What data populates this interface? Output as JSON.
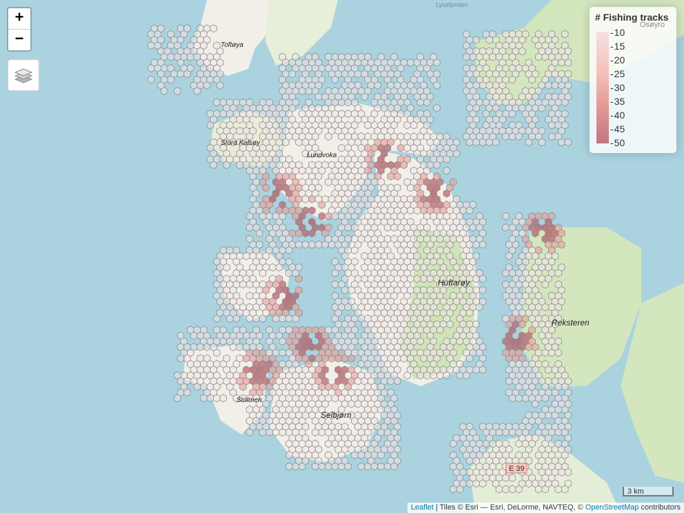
{
  "controls": {
    "zoom_in": "+",
    "zoom_out": "−",
    "layers_icon": "layers-icon"
  },
  "legend": {
    "title": "# Fishing tracks",
    "ticks": [
      "10",
      "15",
      "20",
      "25",
      "30",
      "35",
      "40",
      "45",
      "50"
    ],
    "colors": {
      "low": "#f6dcdc",
      "high": "#b8606b"
    }
  },
  "map_labels": {
    "toftoya": "Toftøya",
    "stora_kalsoy": "Stora Kalsøy",
    "lundvoka": "Lundvoka",
    "huftaroy": "Huftarøy",
    "reksteren": "Reksteren",
    "stolmen": "Stolmen",
    "selbjorn": "Selbjørn",
    "osoyro": "Osøyro",
    "lysefjorden": "Lysefjorden",
    "road": "E 39"
  },
  "colors": {
    "water": "#aad3df",
    "land": "#f2efe9",
    "forest": "#cfe5b8",
    "hex_stroke": "#8c8c8c"
  },
  "scale": "3 km",
  "attribution": {
    "leaflet": "Leaflet",
    "tiles": " | Tiles © Esri — Esri, DeLorme, NAVTEQ, © ",
    "osm": "OpenStreetMap",
    "suffix": " contributors"
  }
}
